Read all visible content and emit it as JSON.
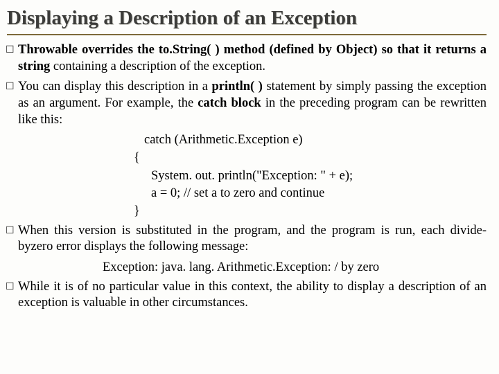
{
  "title": "Displaying a Description of an Exception",
  "bullets": {
    "b1": {
      "pre": "Throwable overrides the to.String( ) method (defined by Object) so that it returns a string ",
      "rest": "containing a description of the exception."
    },
    "b2": {
      "pre1": "You can display this description in a ",
      "println": "println( )",
      "mid1": " statement by simply passing the exception as an argument. For example, the ",
      "catch": "catch block",
      "mid2": " in the preceding program can be rewritten like this:"
    },
    "b3": "When this version is substituted in the program, and the program is run, each divide-byzero error displays the following message:",
    "b4": "While it is of no particular value in this context, the ability to display a description of an exception is valuable in other circumstances."
  },
  "code": {
    "l1": "catch (Arithmetic.Exception e)",
    "l2": "{",
    "l3": "System. out. println(\"Exception: \" + e);",
    "l4": "a = 0; // set a to zero and continue",
    "l5": "}"
  },
  "output_msg": "Exception: java. lang. Arithmetic.Exception: / by zero"
}
